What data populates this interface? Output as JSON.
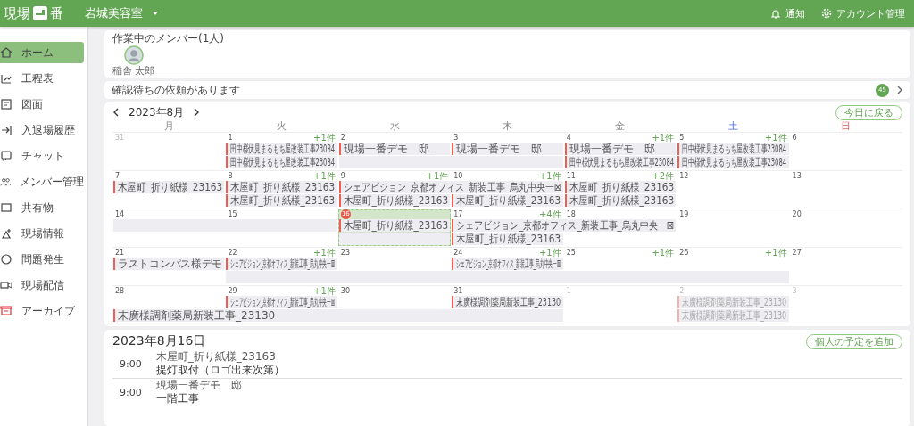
{
  "header": {
    "logo_left": "現場",
    "logo_right": "番",
    "site": "岩城美容室",
    "actions": [
      {
        "kind": "bell",
        "label": "通知"
      },
      {
        "kind": "gear",
        "label": "アカウント管理"
      }
    ]
  },
  "sidebar": {
    "items": [
      {
        "kind": "home",
        "label": "ホーム",
        "selected": true
      },
      {
        "kind": "schedule",
        "label": "工程表",
        "selected": false
      },
      {
        "kind": "drawing",
        "label": "図面",
        "selected": false
      },
      {
        "kind": "entry",
        "label": "入退場履歴",
        "selected": false
      },
      {
        "kind": "chat",
        "label": "チャット",
        "selected": false
      },
      {
        "kind": "members",
        "label": "メンバー管理",
        "selected": false
      },
      {
        "kind": "shared",
        "label": "共有物",
        "selected": false
      },
      {
        "kind": "info",
        "label": "現場情報",
        "selected": false
      },
      {
        "kind": "problem",
        "label": "問題発生",
        "selected": false
      },
      {
        "kind": "stream",
        "label": "現場配信",
        "selected": false
      },
      {
        "kind": "archive",
        "label": "アーカイブ",
        "selected": false
      }
    ]
  },
  "members": {
    "title": "作業中のメンバー(1人)",
    "people": [
      {
        "name": "稲舎 太郎"
      }
    ]
  },
  "pending": {
    "text": "確認待ちの依頼があります",
    "count": "45"
  },
  "calendar": {
    "month": "2023年8月",
    "today_button": "今日に戻る",
    "weekdays": [
      {
        "label": "月",
        "kind": "weekday"
      },
      {
        "label": "火",
        "kind": "weekday"
      },
      {
        "label": "水",
        "kind": "weekday"
      },
      {
        "label": "木",
        "kind": "weekday"
      },
      {
        "label": "金",
        "kind": "weekday"
      },
      {
        "label": "土",
        "kind": "saturday"
      },
      {
        "label": "日",
        "kind": "sunday"
      }
    ],
    "weeks": [
      {
        "days": [
          {
            "date": "31",
            "muted": true,
            "today": false
          },
          {
            "date": "1",
            "muted": false,
            "today": false,
            "more": "+1件",
            "slots": [
              {
                "kind": "event",
                "title": "田中様伏見まるもち屋改装工事23084",
                "faded": false
              },
              {
                "kind": "event",
                "title": "田中様伏見まるもち屋改装工事23084",
                "faded": false
              }
            ]
          },
          {
            "date": "2",
            "muted": false,
            "today": false,
            "slots": [
              {
                "kind": "event",
                "title": "現場一番デモ　邸",
                "faded": false
              },
              {
                "kind": "empty"
              }
            ]
          },
          {
            "date": "3",
            "muted": false,
            "today": false,
            "slots": [
              {
                "kind": "event",
                "title": "現場一番デモ　邸",
                "faded": false
              },
              {
                "kind": "empty"
              }
            ]
          },
          {
            "date": "4",
            "muted": false,
            "today": false,
            "more": "+1件",
            "slots": [
              {
                "kind": "event",
                "title": "現場一番デモ　邸",
                "faded": false
              },
              {
                "kind": "event",
                "title": "田中様伏見まるもち屋改装工事23084",
                "faded": false
              }
            ]
          },
          {
            "date": "5",
            "muted": false,
            "today": false,
            "more": "+1件",
            "slots": [
              {
                "kind": "event",
                "title": "田中様伏見まるもち屋改装工事23084",
                "faded": false
              },
              {
                "kind": "event",
                "title": "田中様伏見まるもち屋改装工事23084",
                "faded": false
              }
            ]
          },
          {
            "date": "6",
            "muted": false,
            "today": false
          }
        ]
      },
      {
        "days": [
          {
            "date": "7",
            "muted": false,
            "today": false,
            "slots": [
              {
                "kind": "event",
                "title": "木屋町_折り紙様_23163",
                "faded": false
              }
            ]
          },
          {
            "date": "8",
            "muted": false,
            "today": false,
            "more": "+1件",
            "slots": [
              {
                "kind": "event",
                "title": "木屋町_折り紙様_23163",
                "faded": false
              },
              {
                "kind": "event",
                "title": "木屋町_折り紙様_23163",
                "faded": false
              }
            ]
          },
          {
            "date": "9",
            "muted": false,
            "today": false,
            "more": "+1件",
            "slots": [
              {
                "kind": "event",
                "title": "シェアビジョン_京都オフィス_新装工事_烏丸中央一⊠",
                "faded": false
              },
              {
                "kind": "event",
                "title": "木屋町_折り紙様_23163",
                "faded": false
              }
            ]
          },
          {
            "date": "10",
            "muted": false,
            "today": false,
            "more": "+1件",
            "slots": [
              {
                "kind": "continued"
              },
              {
                "kind": "event",
                "title": "木屋町_折り紙様_23163",
                "faded": false
              }
            ]
          },
          {
            "date": "11",
            "muted": false,
            "today": false,
            "more": "+2件",
            "slots": [
              {
                "kind": "event",
                "title": "木屋町_折り紙様_23163",
                "faded": false
              },
              {
                "kind": "event",
                "title": "木屋町_折り紙様_23163",
                "faded": false
              }
            ]
          },
          {
            "date": "12",
            "muted": false,
            "today": false
          },
          {
            "date": "13",
            "muted": false,
            "today": false
          }
        ]
      },
      {
        "days": [
          {
            "date": "14",
            "muted": false,
            "today": false,
            "slots": [
              {
                "kind": "empty"
              }
            ]
          },
          {
            "date": "15",
            "muted": false,
            "today": false,
            "slots": [
              {
                "kind": "empty"
              }
            ]
          },
          {
            "date": "16",
            "muted": false,
            "today": true,
            "slots": [
              {
                "kind": "event",
                "title": "木屋町_折り紙様_23163",
                "faded": false
              },
              {
                "kind": "empty"
              }
            ]
          },
          {
            "date": "17",
            "muted": false,
            "today": false,
            "more": "+4件",
            "slots": [
              {
                "kind": "event",
                "title": "シェアビジョン_京都オフィス_新装工事_烏丸中央一⊠",
                "faded": false
              },
              {
                "kind": "event",
                "title": "木屋町_折り紙様_23163",
                "faded": false
              }
            ]
          },
          {
            "date": "18",
            "muted": false,
            "today": false,
            "slots": [
              {
                "kind": "continued"
              }
            ]
          },
          {
            "date": "19",
            "muted": false,
            "today": false
          },
          {
            "date": "20",
            "muted": false,
            "today": false
          }
        ]
      },
      {
        "days": [
          {
            "date": "21",
            "muted": false,
            "today": false,
            "slots": [
              {
                "kind": "event",
                "title": "ラストコンパス様デモ",
                "faded": false
              }
            ]
          },
          {
            "date": "22",
            "muted": false,
            "today": false,
            "more": "+1件",
            "slots": [
              {
                "kind": "event",
                "title": "シェアビジョン_京都オフィス_新装工事_烏丸中央一⊠",
                "faded": false
              },
              {
                "kind": "empty"
              }
            ]
          },
          {
            "date": "23",
            "muted": false,
            "today": false,
            "slots": [
              {
                "kind": "blank"
              },
              {
                "kind": "empty"
              }
            ]
          },
          {
            "date": "24",
            "muted": false,
            "today": false,
            "more": "+1件",
            "slots": [
              {
                "kind": "event",
                "title": "シェアビジョン_京都オフィス_新装工事_烏丸中央一⊠",
                "faded": false
              },
              {
                "kind": "empty"
              }
            ]
          },
          {
            "date": "25",
            "muted": false,
            "today": false,
            "more": "+1件",
            "slots": [
              {
                "kind": "blank"
              },
              {
                "kind": "empty"
              }
            ]
          },
          {
            "date": "26",
            "muted": false,
            "today": false,
            "more": "+1件",
            "slots": [
              {
                "kind": "blank"
              },
              {
                "kind": "empty"
              }
            ]
          },
          {
            "date": "27",
            "muted": false,
            "today": false
          }
        ]
      },
      {
        "days": [
          {
            "date": "28",
            "muted": false,
            "today": false,
            "slots": [
              {
                "kind": "blank"
              },
              {
                "kind": "event",
                "title": "末廣様調剤薬局新装工事_23130",
                "faded": false
              }
            ]
          },
          {
            "date": "29",
            "muted": false,
            "today": false,
            "more": "+1件",
            "slots": [
              {
                "kind": "event",
                "title": "シェアビジョン_京都オフィス_新装工事_烏丸中央一⊠",
                "faded": false
              },
              {
                "kind": "continued"
              }
            ]
          },
          {
            "date": "30",
            "muted": false,
            "today": false,
            "slots": [
              {
                "kind": "blank"
              },
              {
                "kind": "continued"
              }
            ]
          },
          {
            "date": "31",
            "muted": false,
            "today": false,
            "slots": [
              {
                "kind": "event",
                "title": "末廣様調剤薬局新装工事_23130",
                "faded": false
              },
              {
                "kind": "continued"
              }
            ]
          },
          {
            "date": "1",
            "muted": true,
            "today": false
          },
          {
            "date": "2",
            "muted": true,
            "today": false,
            "slots": [
              {
                "kind": "event",
                "title": "末廣様調剤薬局新装工事_23130",
                "faded": true
              },
              {
                "kind": "event",
                "title": "末廣様調剤薬局新装工事_23130",
                "faded": true
              }
            ]
          },
          {
            "date": "3",
            "muted": true,
            "today": false
          }
        ]
      }
    ]
  },
  "schedule": {
    "date": "2023年8月16日",
    "add_button": "個人の予定を追加",
    "items": [
      {
        "time": "9:00",
        "site": "木屋町_折り紙様_23163",
        "title": "提灯取付（ロゴ出来次第）"
      },
      {
        "time": "9:00",
        "site": "現場一番デモ　邸",
        "title": "一階工事"
      }
    ]
  }
}
